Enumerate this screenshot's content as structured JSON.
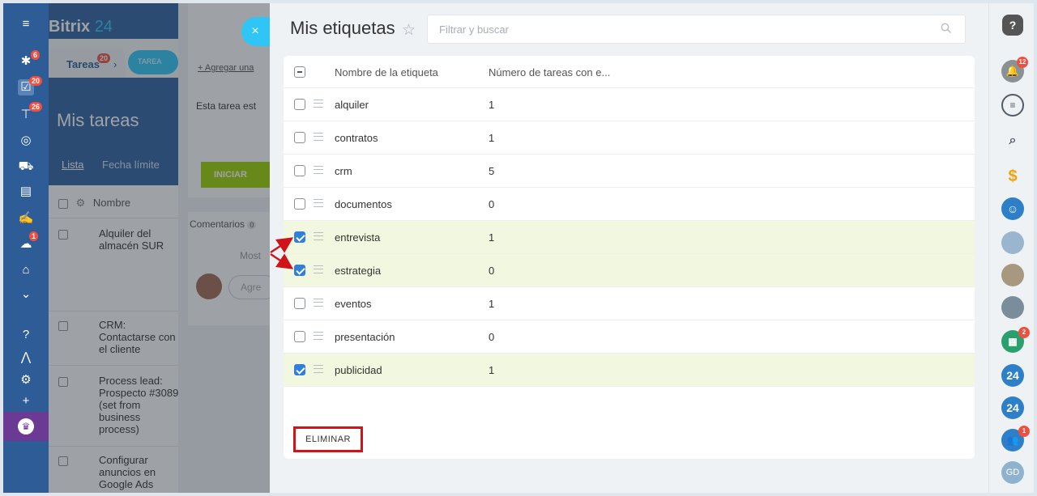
{
  "colors": {
    "nav_bg": "#2d5c96",
    "accent": "#2fc6f6",
    "selected_row": "#f1f8df",
    "checkbox_on": "#2f7fdc",
    "highlight": "#d0151a",
    "start_button": "#9dcf00"
  },
  "background": {
    "brand_main": "Bitrix",
    "brand_num": "24",
    "nav_badges": {
      "feed": "6",
      "tasks": "20",
      "crm": "26",
      "chats": "1"
    },
    "tab_tasks": "Tareas",
    "tab_tasks_badge": "20",
    "tab_task": "TAREA",
    "page_title": "Mis tareas",
    "view_list": "Lista",
    "view_deadline": "Fecha límite",
    "col_name": "Nombre",
    "tasks": [
      "Alquiler del almacén SUR",
      "CRM: Contactarse con el cliente",
      "Process lead: Prospecto #3089 (set from business process)",
      "Configurar anuncios en Google Ads"
    ],
    "add_link": "+ Agregar una",
    "task_status": "Esta tarea est",
    "start_button": "INICIAR",
    "comments": "Comentarios",
    "comments_count": "0",
    "show_more": "Most",
    "comment_placeholder": "Agre"
  },
  "panel": {
    "title": "Mis etiquetas",
    "star_icon": "star-icon",
    "search_placeholder": "Filtrar y buscar",
    "columns": [
      "Nombre de la etiqueta",
      "Número de tareas con e..."
    ],
    "rows": [
      {
        "name": "alquiler",
        "count": "1",
        "checked": false
      },
      {
        "name": "contratos",
        "count": "1",
        "checked": false
      },
      {
        "name": "crm",
        "count": "5",
        "checked": false
      },
      {
        "name": "documentos",
        "count": "0",
        "checked": false
      },
      {
        "name": "entrevista",
        "count": "1",
        "checked": true
      },
      {
        "name": "estrategia",
        "count": "0",
        "checked": true
      },
      {
        "name": "eventos",
        "count": "1",
        "checked": false
      },
      {
        "name": "presentación",
        "count": "0",
        "checked": false
      },
      {
        "name": "publicidad",
        "count": "1",
        "checked": true
      }
    ],
    "delete_button": "ELIMINAR",
    "close_icon": "close-icon"
  },
  "rightbar": {
    "help_icon": "?",
    "notifications_badge": "12",
    "calendar_badge": "2",
    "b24_a": "24",
    "b24_b": "24",
    "group_badge": "1",
    "user_initials": "GD"
  }
}
